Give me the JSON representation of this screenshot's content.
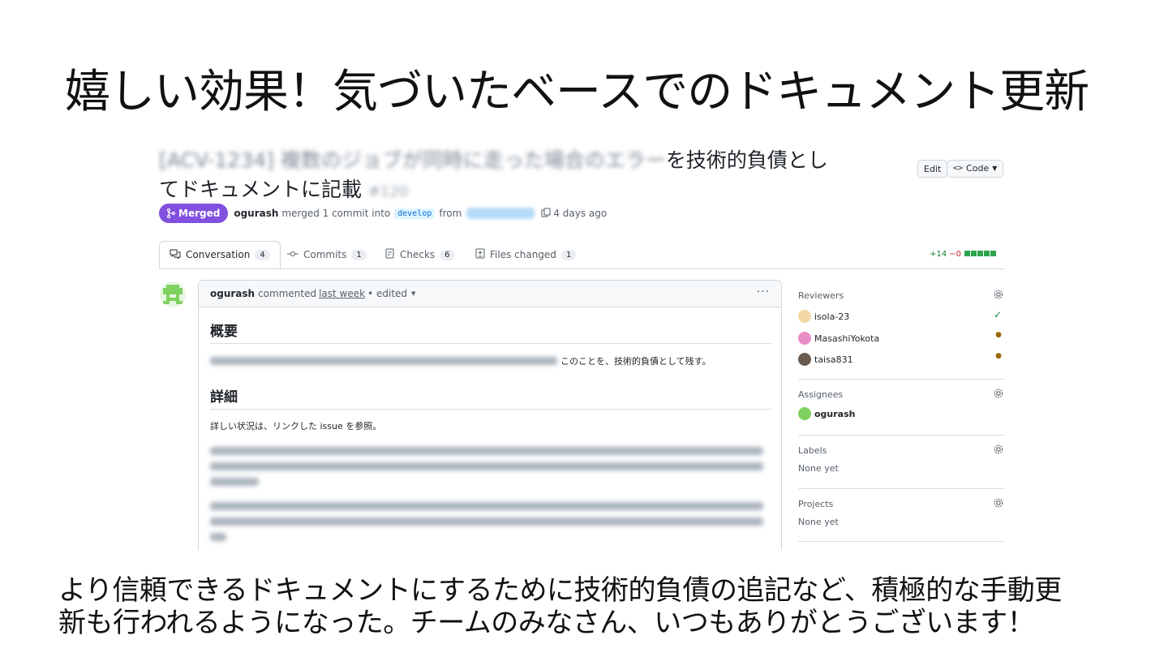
{
  "slide": {
    "title": "嬉しい効果！気づいたベースでのドキュメント更新",
    "bottom_line1": "より信頼できるドキュメントにするために技術的負債の追記など、積極的な手動更",
    "bottom_line2": "新も行われるようになった。チームのみなさん、いつもありがとうございます！"
  },
  "pr": {
    "title_blurred": "[ACV-1234] 複数のジョブが同時に走った場合のエラー",
    "title_visible_1": "を技術的負債とし",
    "title_visible_2": "てドキュメントに記載",
    "number_blurred": "#120",
    "edit_label": "Edit",
    "code_label": "Code",
    "status_label": "Merged",
    "author": "ogurash",
    "merge_text": "merged 1 commit into",
    "base_branch": "develop",
    "from_text": "from",
    "time_ago": "4 days ago"
  },
  "tabs": [
    {
      "label": "Conversation",
      "count": "4"
    },
    {
      "label": "Commits",
      "count": "1"
    },
    {
      "label": "Checks",
      "count": "6"
    },
    {
      "label": "Files changed",
      "count": "1"
    }
  ],
  "diffstat": {
    "additions": "+14",
    "deletions": "−0"
  },
  "comment": {
    "author": "ogurash",
    "commented": "commented",
    "when": "last week",
    "edited": "• edited",
    "menu": "···",
    "heading1": "概要",
    "para1_visible": "このことを、技術的負債として残す。",
    "heading2": "詳細",
    "para2": "詳しい状況は、リンクした issue を参照。"
  },
  "sidebar": {
    "reviewers_title": "Reviewers",
    "reviewers": [
      {
        "name": "isola-23",
        "status": "✓",
        "status_color": "#1a7f37",
        "avatar_color": "#f3d7a4"
      },
      {
        "name": "MasashiYokota",
        "status": "●",
        "status_color": "#9a6700",
        "avatar_color": "#e88dc5"
      },
      {
        "name": "taisa831",
        "status": "●",
        "status_color": "#9a6700",
        "avatar_color": "#6b5a4e"
      }
    ],
    "assignees_title": "Assignees",
    "assignee": "ogurash",
    "labels_title": "Labels",
    "labels_value": "None yet",
    "projects_title": "Projects",
    "projects_value": "None yet"
  },
  "colors": {
    "merged": "#8250df",
    "accent_green": "#2da44e"
  }
}
